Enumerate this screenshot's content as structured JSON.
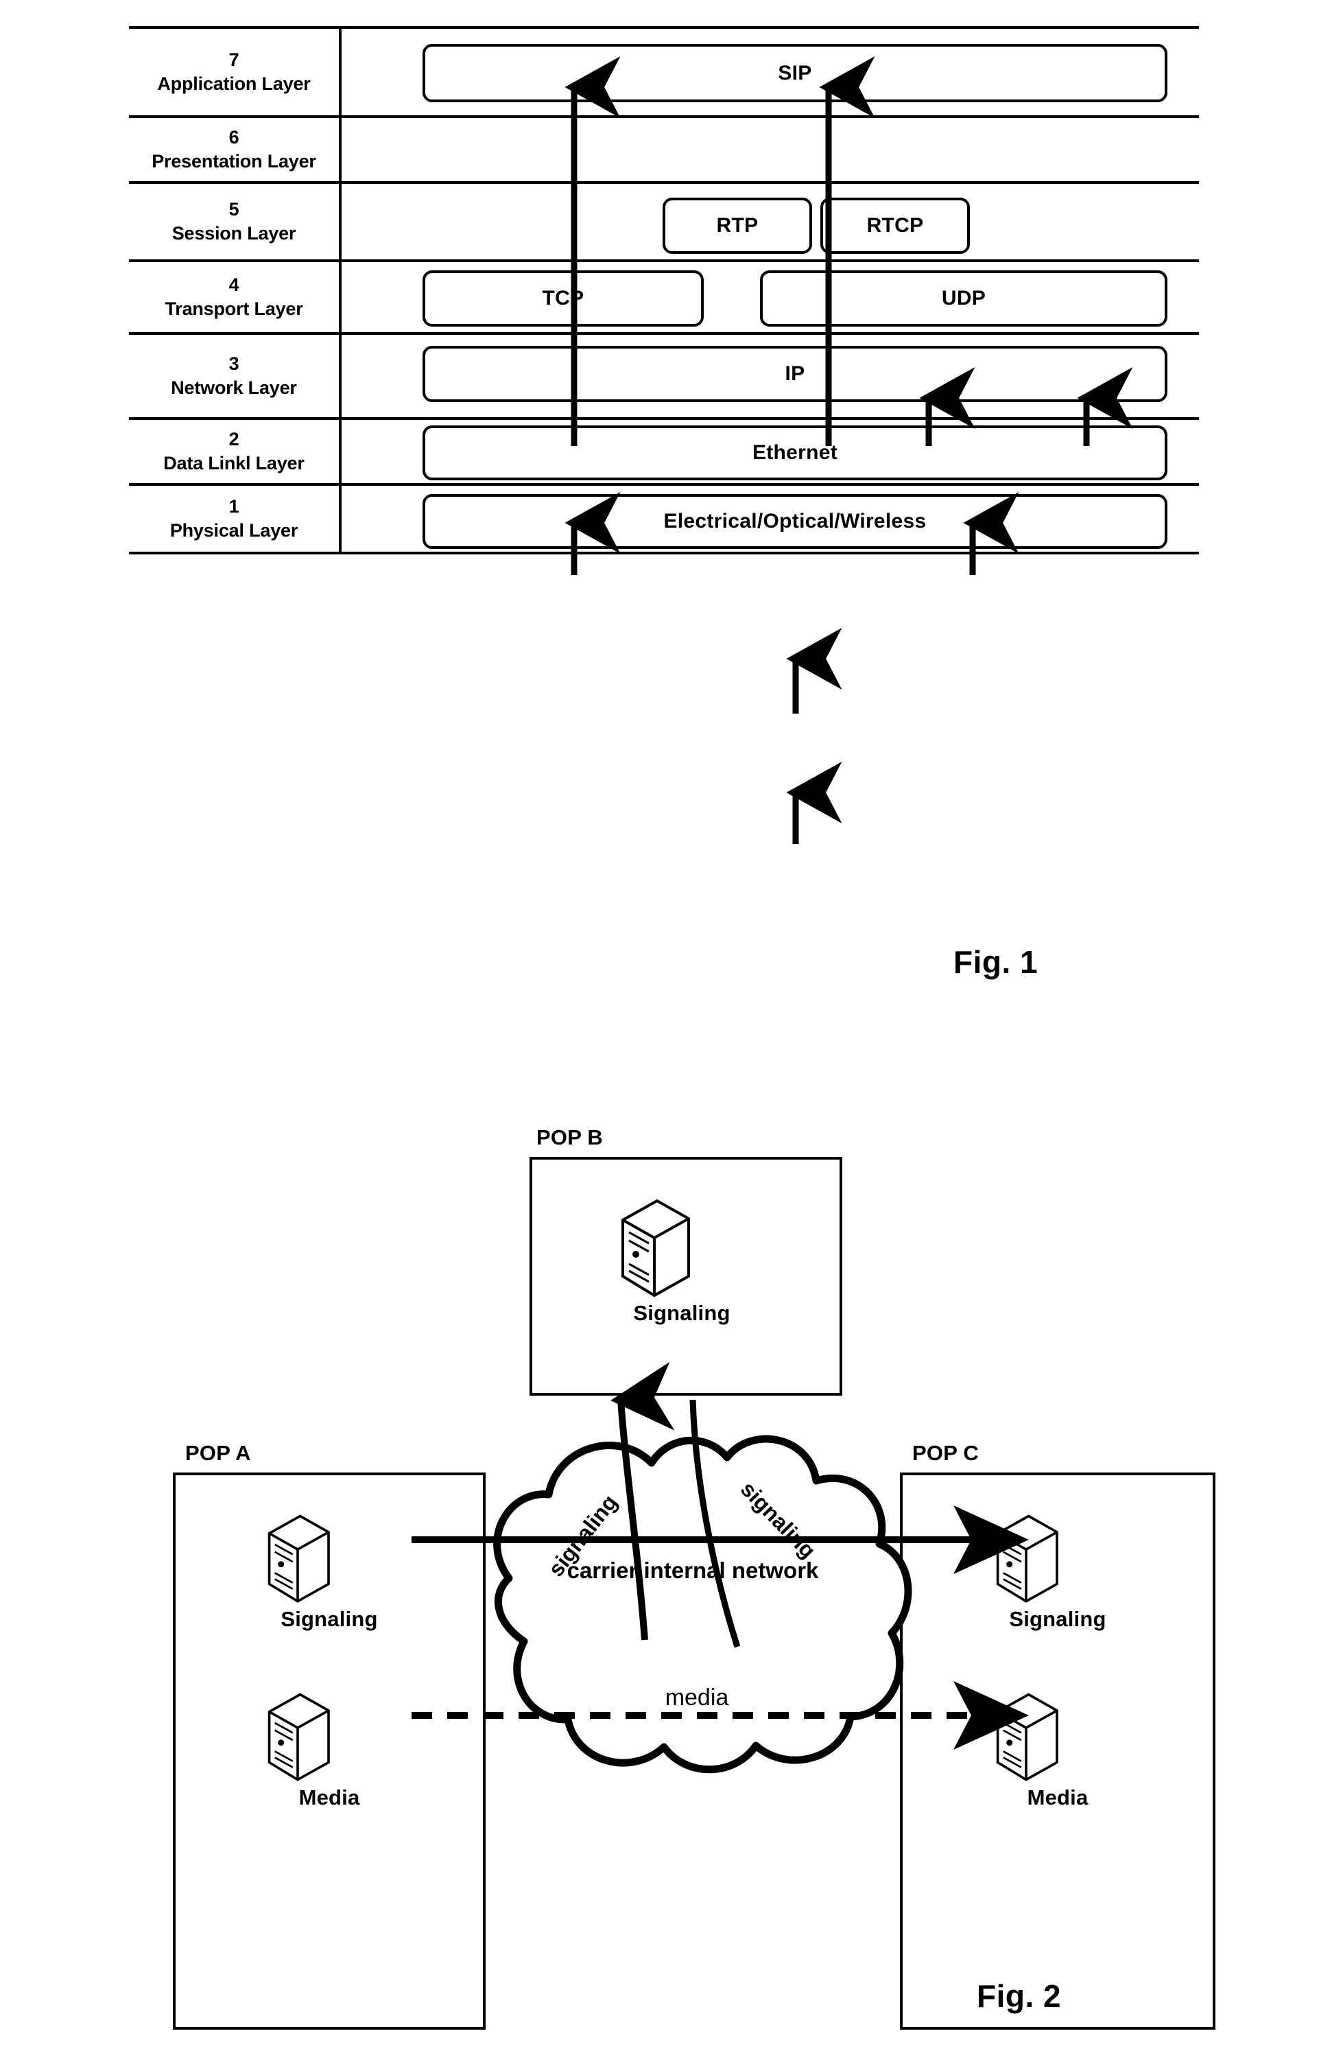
{
  "figure1": {
    "caption": "Fig. 1",
    "layers": [
      {
        "number": "7",
        "name": "Application Layer"
      },
      {
        "number": "6",
        "name": "Presentation Layer"
      },
      {
        "number": "5",
        "name": "Session Layer"
      },
      {
        "number": "4",
        "name": "Transport Layer"
      },
      {
        "number": "3",
        "name": "Network Layer"
      },
      {
        "number": "2",
        "name": "Data Linkl Layer"
      },
      {
        "number": "1",
        "name": "Physical Layer"
      }
    ],
    "protocols": {
      "sip": "SIP",
      "rtp": "RTP",
      "rtcp": "RTCP",
      "tcp": "TCP",
      "udp": "UDP",
      "ip": "IP",
      "ethernet": "Ethernet",
      "physical": "Electrical/Optical/Wireless"
    }
  },
  "figure2": {
    "caption": "Fig. 2",
    "pops": {
      "a": {
        "title": "POP A",
        "nodes": [
          {
            "label": "Signaling",
            "icon": "server-icon"
          },
          {
            "label": "Media",
            "icon": "server-icon"
          }
        ]
      },
      "b": {
        "title": "POP B",
        "nodes": [
          {
            "label": "Signaling",
            "icon": "server-icon"
          }
        ]
      },
      "c": {
        "title": "POP C",
        "nodes": [
          {
            "label": "Signaling",
            "icon": "server-icon"
          },
          {
            "label": "Media",
            "icon": "server-icon"
          }
        ]
      }
    },
    "cloud": {
      "label": "carrier internal network",
      "signaling_left": "signaling",
      "signaling_right": "signaling"
    },
    "flows": {
      "media": "media"
    }
  },
  "colors": {
    "ink": "#000000",
    "paper": "#ffffff"
  }
}
